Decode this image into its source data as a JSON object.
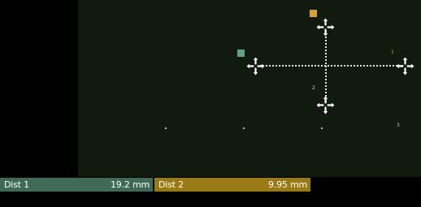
{
  "measurements": [
    {
      "label": "Dist 1",
      "value": "19.2 mm",
      "color": "#3f6a58"
    },
    {
      "label": "Dist 2",
      "value": "9.95 mm",
      "color": "#9a7a14"
    }
  ],
  "marker_colors": {
    "dist_1_marker": "#5fa089",
    "dist_2_marker": "#d8a230"
  },
  "point_labels": {
    "right": "1",
    "bottom": "2",
    "scale_right": "3"
  },
  "icons": {
    "endpoint": "crosshair-handle-icon"
  }
}
